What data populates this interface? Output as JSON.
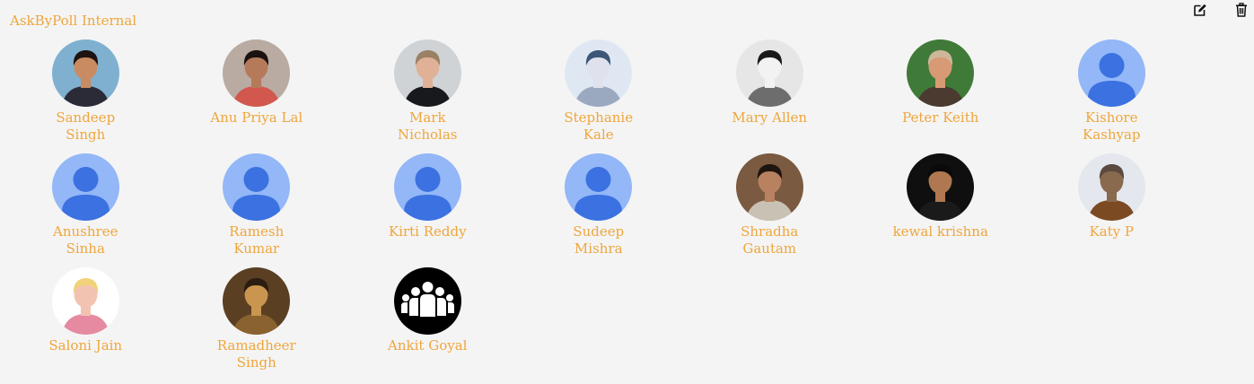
{
  "group": {
    "title": "AskByPoll Internal"
  },
  "toolbar": {
    "edit_icon": "edit-icon",
    "delete_icon": "trash-icon"
  },
  "colors": {
    "accent": "#efa63c",
    "background": "#f4f4f4",
    "default_avatar_bg": "#93b7f7",
    "default_avatar_fg": "#3b71e0"
  },
  "members": [
    {
      "name": "Sandeep Singh",
      "avatar": "photo",
      "photo": {
        "bg": "#7fb0cf",
        "skin": "#c98b62",
        "body": "#2b2b38",
        "hair": "#1c1410"
      }
    },
    {
      "name": "Anu Priya Lal",
      "avatar": "photo",
      "photo": {
        "bg": "#b9aaa2",
        "skin": "#b57a5a",
        "body": "#d1574f",
        "hair": "#1a1210"
      }
    },
    {
      "name": "Mark Nicholas",
      "avatar": "photo",
      "photo": {
        "bg": "#cfd3d6",
        "skin": "#e0b196",
        "body": "#17191c",
        "hair": "#9a8064"
      }
    },
    {
      "name": "Stephanie Kale",
      "avatar": "photo",
      "photo": {
        "bg": "#dfe8f2",
        "skin": "#dfe2ec",
        "body": "#9aa9c0",
        "hair": "#3c5677"
      }
    },
    {
      "name": "Mary Allen",
      "avatar": "photo",
      "photo": {
        "bg": "#e6e6e6",
        "skin": "#f2f2f2",
        "body": "#6d6d6d",
        "hair": "#1a1a1a"
      }
    },
    {
      "name": "Peter Keith",
      "avatar": "photo",
      "photo": {
        "bg": "#3f7a38",
        "skin": "#d79a74",
        "body": "#4a3a30",
        "hair": "#cdb79a"
      }
    },
    {
      "name": "Kishore Kashyap",
      "avatar": "default"
    },
    {
      "name": "Anushree Sinha",
      "avatar": "default"
    },
    {
      "name": "Ramesh Kumar",
      "avatar": "default"
    },
    {
      "name": "Kirti Reddy",
      "avatar": "default"
    },
    {
      "name": "Sudeep Mishra",
      "avatar": "default"
    },
    {
      "name": "Shradha Gautam",
      "avatar": "photo",
      "photo": {
        "bg": "#7a5a40",
        "skin": "#b88260",
        "body": "#c9c2b4",
        "hair": "#1e1510"
      }
    },
    {
      "name": "kewal krishna",
      "avatar": "photo",
      "photo": {
        "bg": "#0f0f0f",
        "skin": "#b07850",
        "body": "#1a1a1a",
        "hair": "#0a0a0a"
      }
    },
    {
      "name": "Katy P",
      "avatar": "photo",
      "photo": {
        "bg": "#e4e7ee",
        "skin": "#8a6a4e",
        "body": "#7b4a22",
        "hair": "#5a4a40"
      }
    },
    {
      "name": "Saloni Jain",
      "avatar": "photo",
      "photo": {
        "bg": "#ffffff",
        "skin": "#f3c3b2",
        "body": "#e58aa0",
        "hair": "#f1d27a"
      }
    },
    {
      "name": "Ramadheer Singh",
      "avatar": "photo",
      "photo": {
        "bg": "#5a3f22",
        "skin": "#c9954f",
        "body": "#8a6230",
        "hair": "#2b1d10"
      }
    },
    {
      "name": "Ankit Goyal",
      "avatar": "group"
    }
  ]
}
